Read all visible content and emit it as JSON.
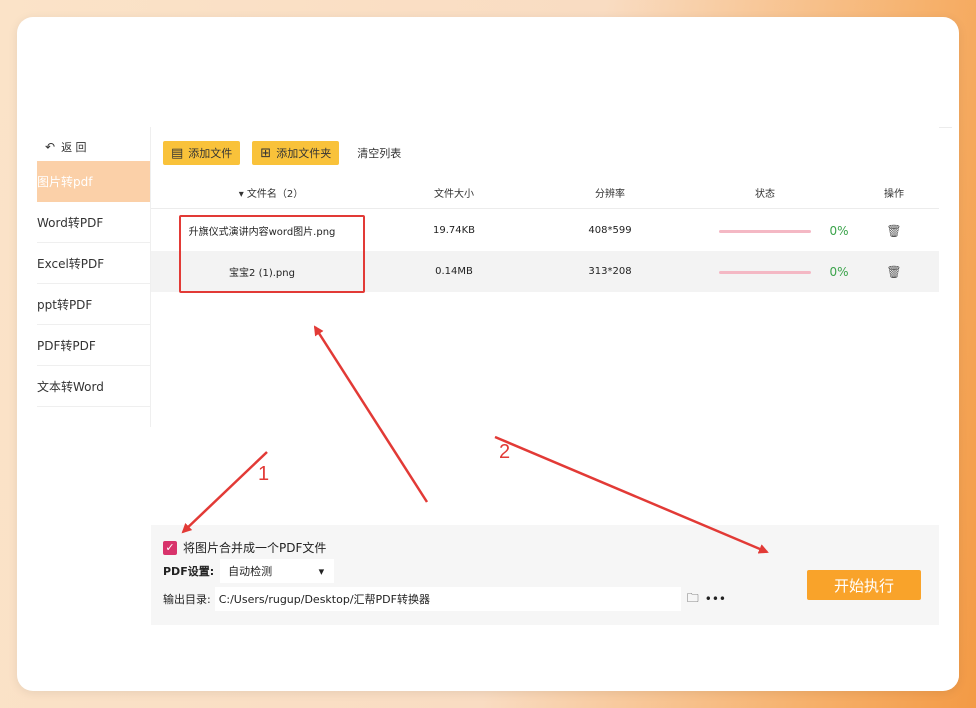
{
  "sidebar": {
    "back_label": "返 回",
    "items": [
      {
        "label": "图片转pdf",
        "active": true
      },
      {
        "label": "Word转PDF",
        "active": false
      },
      {
        "label": "Excel转PDF",
        "active": false
      },
      {
        "label": "ppt转PDF",
        "active": false
      },
      {
        "label": "PDF转PDF",
        "active": false
      },
      {
        "label": "文本转Word",
        "active": false
      }
    ]
  },
  "toolbar": {
    "add_file_label": "添加文件",
    "add_folder_label": "添加文件夹",
    "clear_list_label": "清空列表"
  },
  "table": {
    "headers": {
      "filename": "▾ 文件名（2）",
      "size": "文件大小",
      "resolution": "分辨率",
      "status": "状态",
      "action": "操作"
    },
    "rows": [
      {
        "filename": "升旗仪式演讲内容word图片.png",
        "size": "19.74KB",
        "resolution": "408*599",
        "progress": 0,
        "progress_label": "0%"
      },
      {
        "filename": "宝宝2 (1).png",
        "size": "0.14MB",
        "resolution": "313*208",
        "progress": 0,
        "progress_label": "0%"
      }
    ]
  },
  "settings": {
    "merge_label": "将图片合并成一个PDF文件",
    "merge_checked": true,
    "pdf_setting_label": "PDF设置:",
    "pdf_setting_value": "自动检测",
    "output_label": "输出目录:",
    "output_path": "C:/Users/rugup/Desktop/汇帮PDF转换器"
  },
  "start_button_label": "开始执行",
  "annotations": {
    "label_1": "1",
    "label_2": "2",
    "color": "#e23a36"
  },
  "colors": {
    "accent": "#f9c23a",
    "start": "#f9a32a",
    "active_nav": "#fbd0a8",
    "checkbox": "#d8336b",
    "progress_text": "#3aa34a"
  }
}
